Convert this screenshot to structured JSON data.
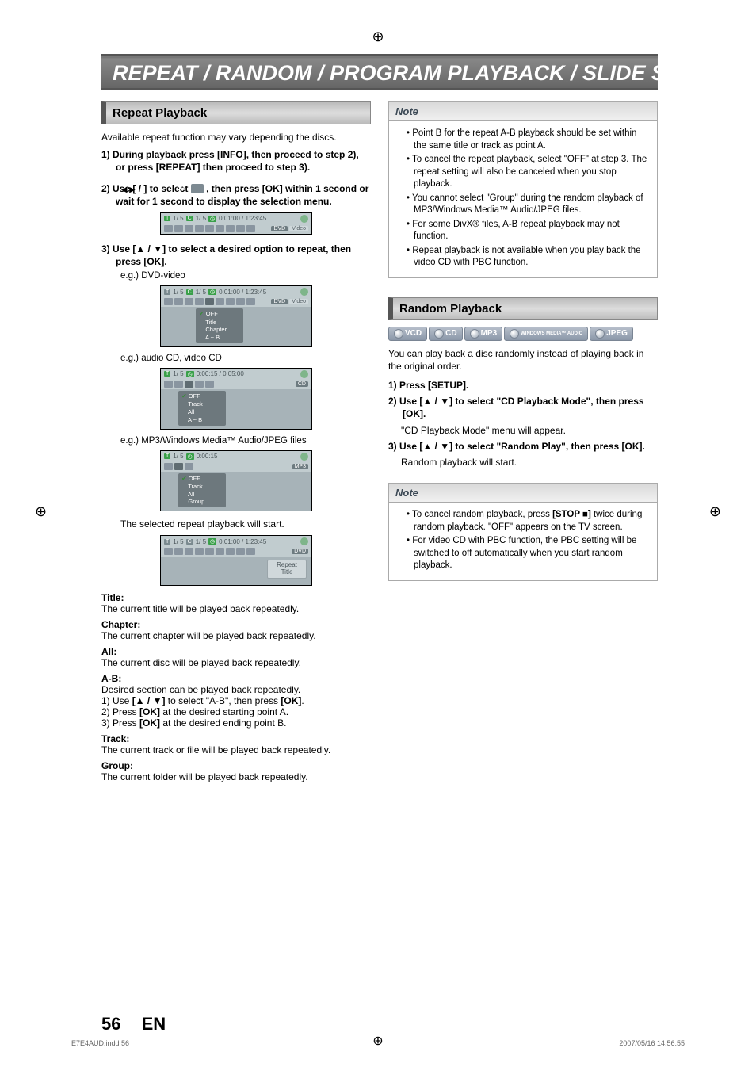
{
  "banner": "REPEAT / RANDOM / PROGRAM PLAYBACK / SLIDE SHOW",
  "left": {
    "heading": "Repeat Playback",
    "intro": "Available repeat function may vary depending the discs.",
    "step1": "1) During playback press [INFO], then proceed to step 2), or press [REPEAT] then proceed to step 3).",
    "step2_a": "2) Use [",
    "step2_b": "] to select ",
    "step2_c": " , then press [OK] within 1 second or wait for 1 second to display the selection menu.",
    "step3": "3) Use [▲ / ▼] to select a desired option to repeat, then press [OK].",
    "eg1": "e.g.) DVD-video",
    "eg2": "e.g.) audio CD, video CD",
    "eg3": "e.g.) MP3/Windows Media™ Audio/JPEG files",
    "sel": "The selected repeat playback will start.",
    "shotA": {
      "t": "T",
      "tc": "1/  5",
      "c": "C",
      "cc": "1/  5",
      "clock": "0:01:00 / 1:23:45",
      "tags": [
        "DVD",
        "Video"
      ]
    },
    "shotB": {
      "menu": [
        "OFF",
        "Title",
        "Chapter",
        "A ~ B"
      ]
    },
    "shotC": {
      "tc": "1/  5",
      "clock": "0:00:15 / 0:05:00",
      "tag": "CD",
      "menu": [
        "OFF",
        "Track",
        "All",
        "A ~ B"
      ]
    },
    "shotD": {
      "tc": "1/  5",
      "clock": "0:00:15",
      "tag": "MP3",
      "menu": [
        "OFF",
        "Track",
        "All",
        "Group"
      ]
    },
    "shotE": {
      "t": "T",
      "tc": "1/  5",
      "c": "C",
      "cc": "1/  5",
      "clock": "0:01:00 / 1:23:45",
      "tag": "DVD",
      "note1": "Repeat",
      "note2": "Title"
    },
    "defs": {
      "title_h": "Title:",
      "title_b": "The current title will be played back repeatedly.",
      "chap_h": "Chapter:",
      "chap_b": "The current chapter will be played back repeatedly.",
      "all_h": "All:",
      "all_b": "The current disc will be played back repeatedly.",
      "ab_h": "A-B:",
      "ab_b": "Desired section can be played back repeatedly.",
      "ab_1": "1) Use [▲ / ▼] to select \"A-B\", then press [OK].",
      "ab_2": "2) Press [OK] at the desired starting point A.",
      "ab_3": "3) Press [OK] at the desired ending point B.",
      "track_h": "Track:",
      "track_b": "The current track or file will be played back repeatedly.",
      "group_h": "Group:",
      "group_b": "The current folder will be played back repeatedly."
    }
  },
  "right": {
    "note1_h": "Note",
    "note1": [
      "Point B for the repeat A-B playback should be set within the same title or track as point A.",
      "To cancel the repeat playback, select \"OFF\" at step 3. The repeat setting will also be canceled when you stop playback.",
      "You cannot select \"Group\" during the random playback of MP3/Windows Media™ Audio/JPEG files.",
      "For some DivX® files, A-B repeat playback may not function.",
      "Repeat playback is not available when you play back the video CD with PBC function."
    ],
    "heading": "Random Playback",
    "formats": [
      "VCD",
      "CD",
      "MP3",
      "WINDOWS MEDIA™ AUDIO",
      "JPEG"
    ],
    "intro": "You can play back a disc randomly instead of playing back in the original order.",
    "s1": "1) Press [SETUP].",
    "s2": "2) Use [▲ / ▼] to select \"CD Playback Mode\", then press [OK].",
    "s2f": "\"CD Playback Mode\" menu will appear.",
    "s3": "3) Use [▲ / ▼] to select \"Random Play\", then press [OK].",
    "s3f": "Random playback will start.",
    "note2_h": "Note",
    "note2": [
      "To cancel random playback, press [STOP ■] twice during random playback. \"OFF\" appears on the TV screen.",
      "For video CD with PBC function, the PBC setting will be switched to off automatically when you start random playback."
    ]
  },
  "footer": {
    "page": "56",
    "lang": "EN",
    "left": "E7E4AUD.indd   56",
    "right": "2007/05/16   14:56:55"
  }
}
